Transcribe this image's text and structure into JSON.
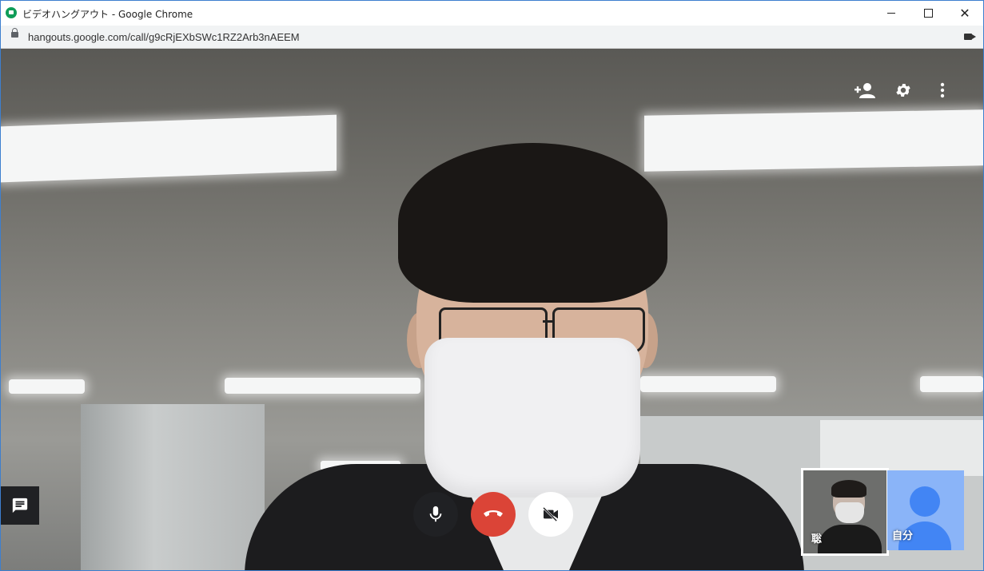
{
  "window": {
    "title": "ビデオハングアウト - Google Chrome"
  },
  "address_bar": {
    "url": "hangouts.google.com/call/g9cRjEXbSWc1RZ2Arb3nAEEM"
  },
  "participants": [
    {
      "label": "聡"
    },
    {
      "label": "自分"
    }
  ],
  "colors": {
    "hangup": "#db4437",
    "avatar_bg": "#8ab4f8",
    "avatar_fg": "#4285f4",
    "control_dark": "#202124"
  },
  "icons": {
    "top_controls": [
      "add-person-icon",
      "settings-icon",
      "more-vert-icon"
    ],
    "bottom_controls": [
      "mic-icon",
      "hangup-icon",
      "camera-off-icon"
    ],
    "chat": "chat-icon"
  }
}
